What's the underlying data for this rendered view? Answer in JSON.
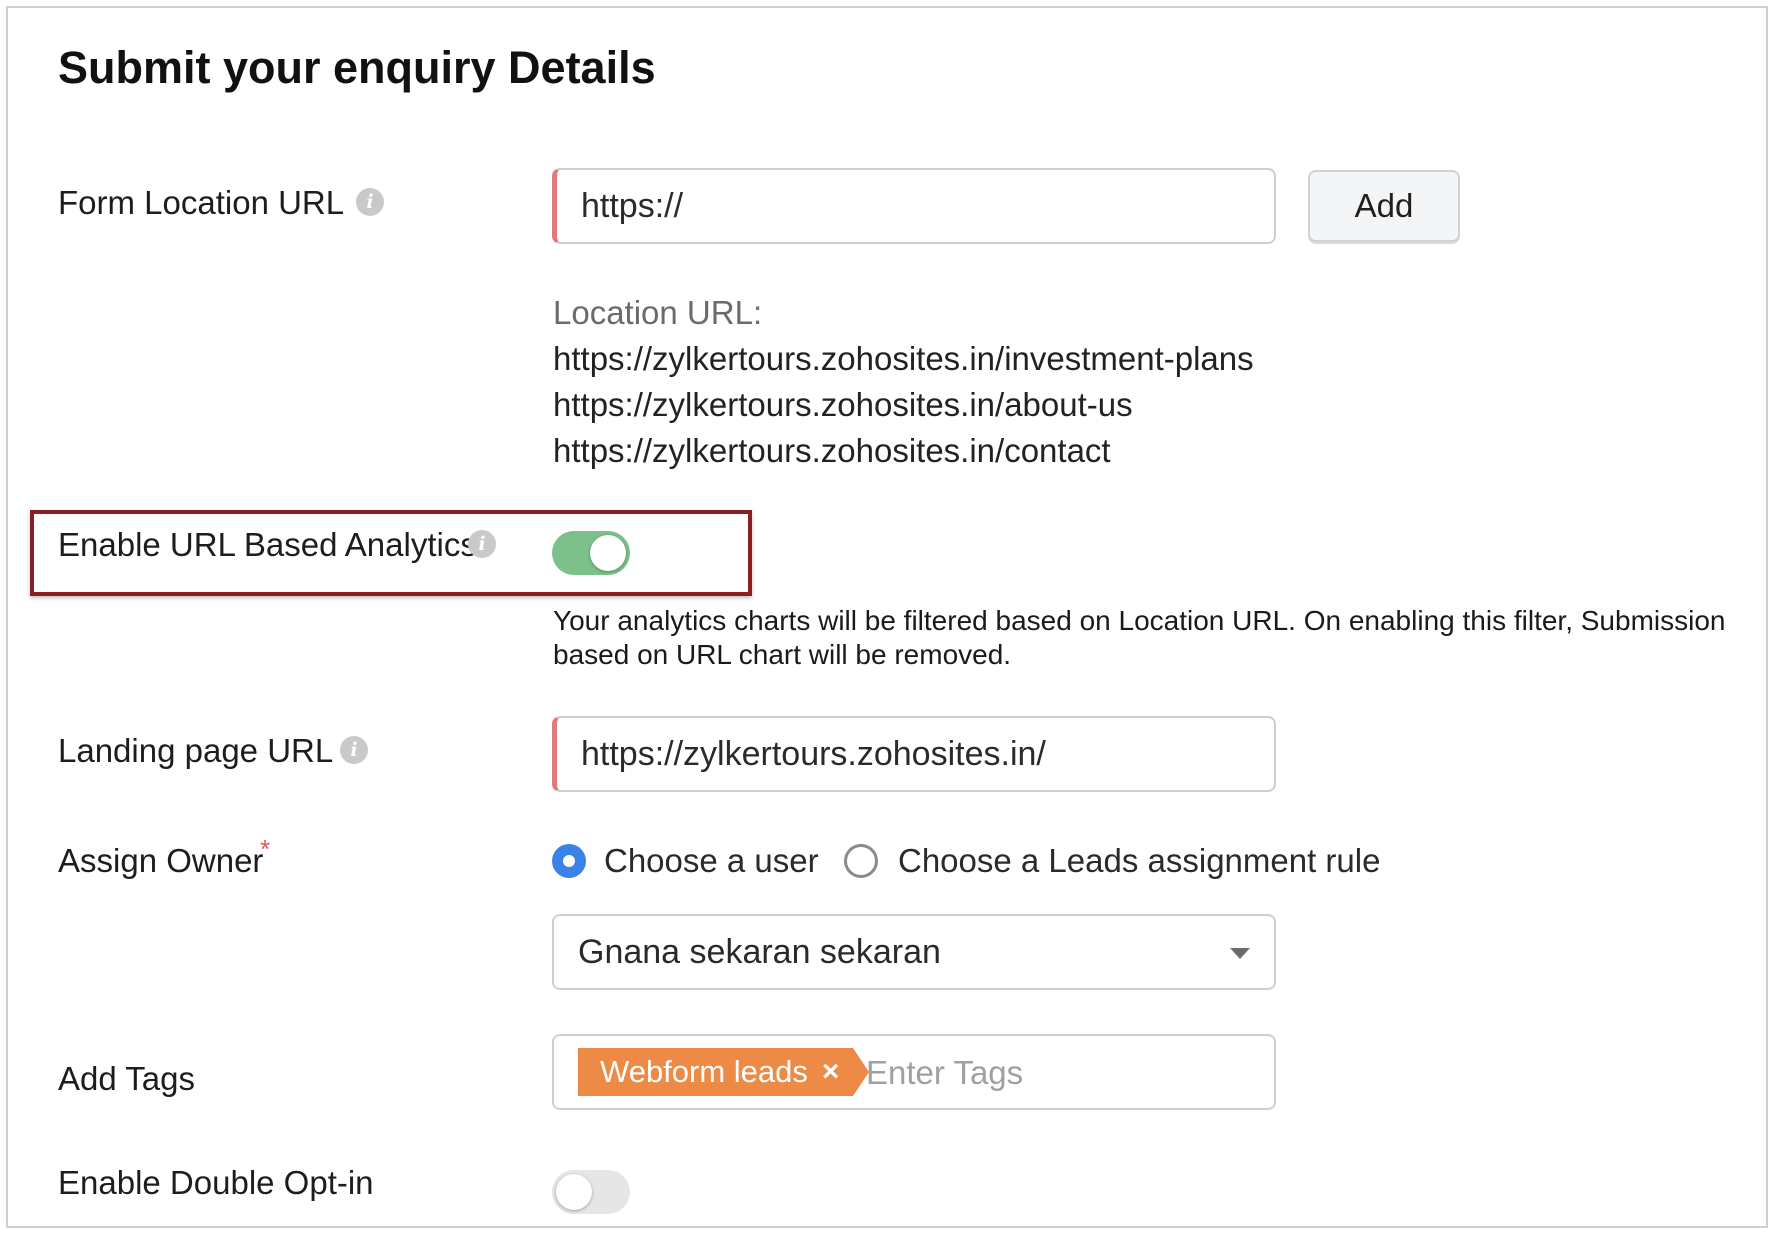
{
  "title": "Submit your enquiry Details",
  "form_location": {
    "label": "Form Location URL",
    "input_value": "https://",
    "add_button": "Add",
    "heading": "Location URL:",
    "urls": [
      "https://zylkertours.zohosites.in/investment-plans",
      "https://zylkertours.zohosites.in/about-us",
      "https://zylkertours.zohosites.in/contact"
    ]
  },
  "url_analytics": {
    "label": "Enable URL Based Analytics",
    "enabled": true,
    "help": "Your analytics charts will be filtered based on Location URL. On enabling this filter, Submission based on URL chart will be removed."
  },
  "landing_page": {
    "label": "Landing page URL",
    "input_value": "https://zylkertours.zohosites.in/"
  },
  "assign_owner": {
    "label": "Assign Owner",
    "required_mark": "*",
    "options": [
      "Choose a user",
      "Choose a Leads assignment rule"
    ],
    "selected_option": "Choose a user",
    "selected_user": "Gnana sekaran sekaran"
  },
  "tags": {
    "label": "Add Tags",
    "tag": "Webform leads",
    "tag_remove": "×",
    "placeholder": "Enter Tags"
  },
  "double_optin": {
    "label": "Enable Double Opt-in",
    "enabled": false
  },
  "info_icon": "i",
  "colors": {
    "toggle_on": "#7cc08a",
    "radio_selected": "#3b82e8",
    "tag": "#ec8a46",
    "highlight_border": "#8b1e1e",
    "required_input_edge": "#e07b7b"
  }
}
